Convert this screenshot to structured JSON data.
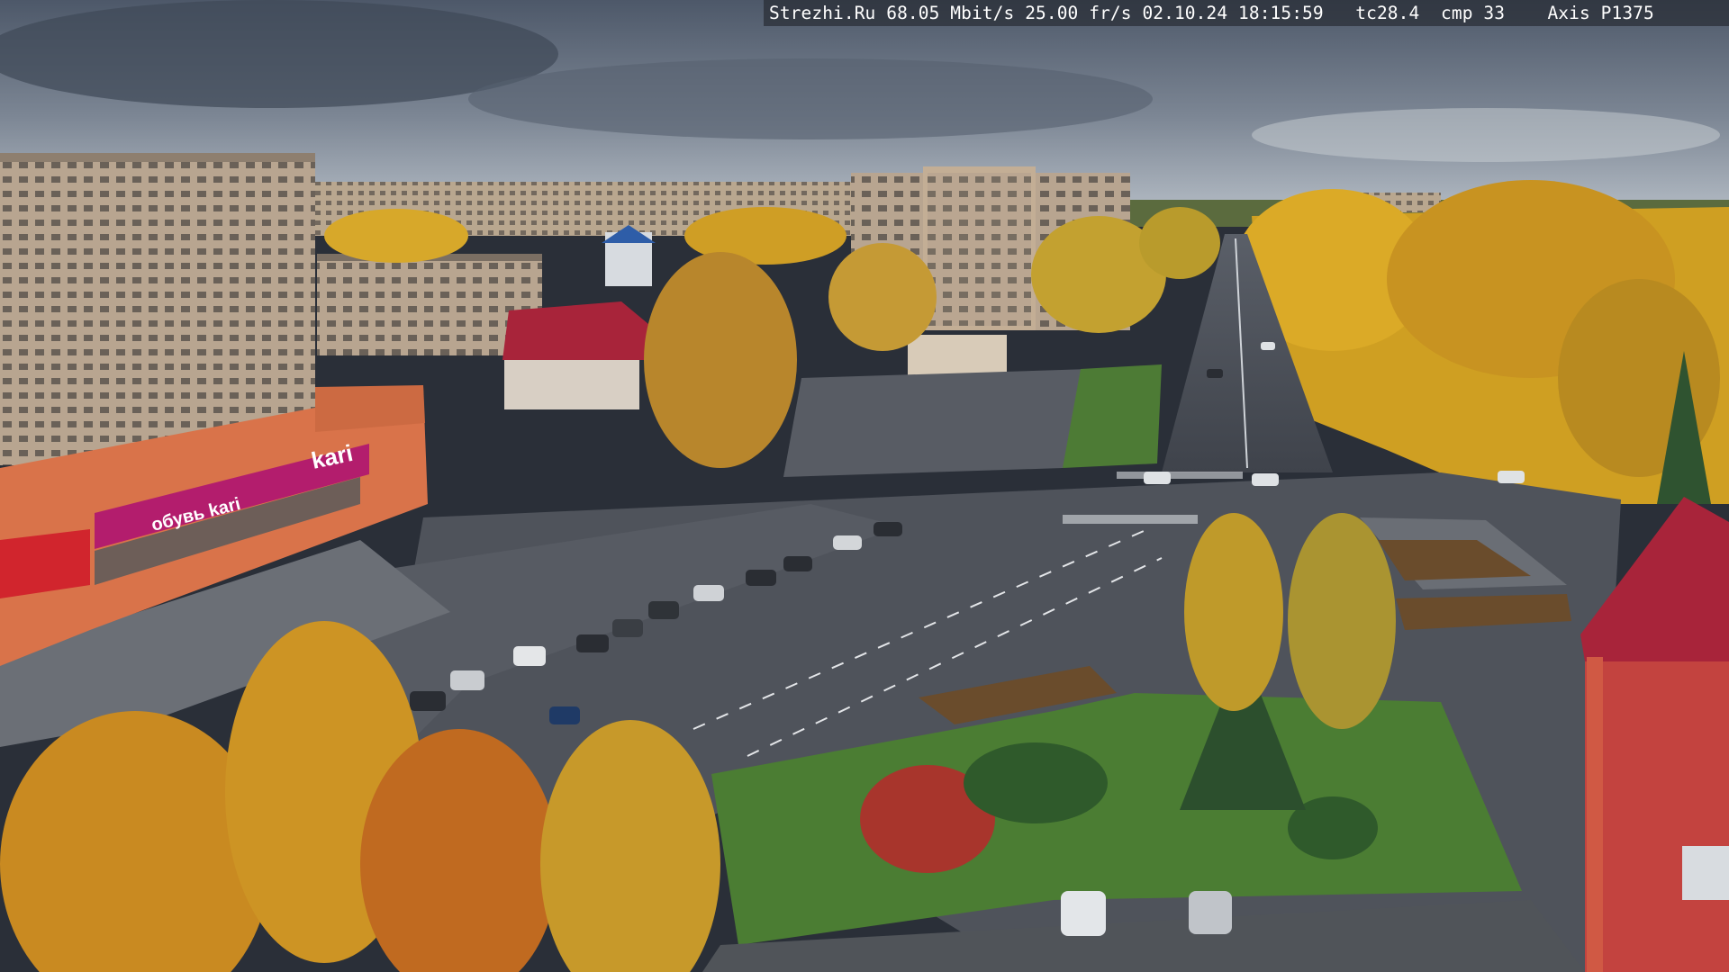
{
  "camera_overlay": {
    "site": "Strezhi.Ru",
    "bitrate": "68.05 Mbit/s",
    "framerate": "25.00 fr/s",
    "date": "02.10.24",
    "time": "18:15:59",
    "tc": "tc28.4",
    "cmp": "cmp 33",
    "model": "Axis P1375"
  },
  "signage": {
    "store_sign": "kari",
    "store_banner": "обувь kari"
  },
  "colors": {
    "sky_top": "#4f5a6b",
    "sky_horizon": "#a9b3bd",
    "foliage_gold": "#d4a52a",
    "foliage_orange": "#c97a22",
    "grass": "#4e7d34",
    "asphalt": "#4b4f57",
    "building_beige": "#b9a28a",
    "building_orange": "#d9734a",
    "roof_red": "#a8243a",
    "banner_magenta": "#b31d6d"
  }
}
